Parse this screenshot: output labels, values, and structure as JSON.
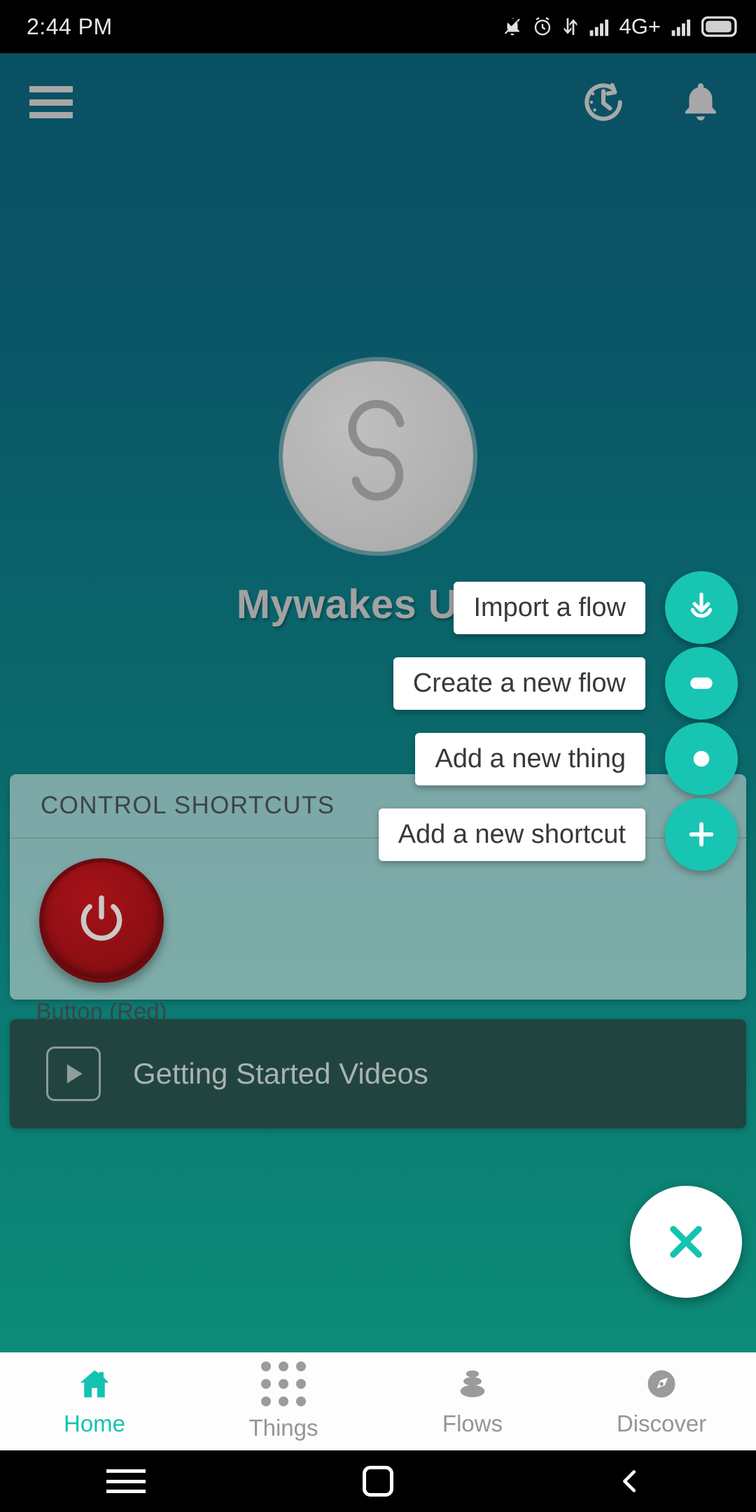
{
  "status_bar": {
    "time": "2:44 PM",
    "icons": [
      "bell-muted-icon",
      "alarm-icon",
      "data-transfer-icon",
      "signal-bars-icon",
      "network-type-label",
      "signal-bars-2-icon",
      "battery-icon"
    ],
    "network_type": "4G+"
  },
  "app_bar": {
    "menu_icon": "hamburger-menu-icon",
    "history_icon": "clock-history-icon",
    "notifications_icon": "bell-icon"
  },
  "profile": {
    "avatar_icon": "user-avatar-s-logo",
    "name": "Mywakes User"
  },
  "shortcuts": {
    "title": "CONTROL SHORTCUTS",
    "items": [
      {
        "label": "Button (Red)",
        "icon": "power-icon",
        "color": "#8e0f14"
      }
    ]
  },
  "video_banner": {
    "icon": "play-icon",
    "label": "Getting Started Videos"
  },
  "fab": {
    "main_icon": "close-icon",
    "main_color": "#ffffff",
    "accent_color": "#18c5b2",
    "actions": [
      {
        "label": "Import a flow",
        "icon": "download-icon"
      },
      {
        "label": "Create a new flow",
        "icon": "pill-icon"
      },
      {
        "label": "Add a new thing",
        "icon": "circle-dot-icon"
      },
      {
        "label": "Add a new shortcut",
        "icon": "plus-icon"
      }
    ]
  },
  "bottom_nav": {
    "active": "Home",
    "active_color": "#13c4b0",
    "inactive_color": "#959595",
    "items": [
      {
        "label": "Home",
        "icon": "home-icon"
      },
      {
        "label": "Things",
        "icon": "grid-dots-icon"
      },
      {
        "label": "Flows",
        "icon": "stacked-stones-icon"
      },
      {
        "label": "Discover",
        "icon": "compass-icon"
      }
    ]
  },
  "android_nav": {
    "menu_icon": "android-menu-icon",
    "home_icon": "android-home-icon",
    "back_icon": "android-back-icon"
  }
}
